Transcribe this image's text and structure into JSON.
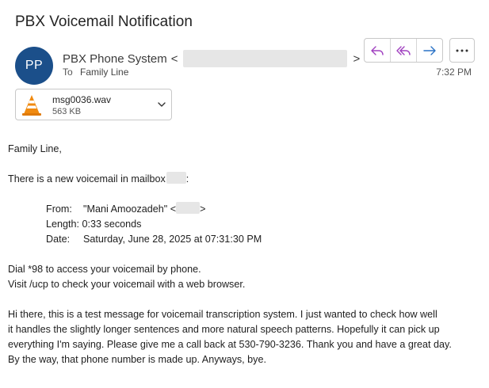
{
  "subject": "PBX Voicemail Notification",
  "sender": {
    "initials": "PP",
    "avatar_color": "#1b4f8a",
    "name": "PBX Phone System",
    "email_open": "<",
    "email_close": ">",
    "to_label": "To",
    "to_value": "Family Line"
  },
  "actions": {
    "icons": [
      "reply-icon",
      "reply-all-icon",
      "forward-icon",
      "more-icon"
    ],
    "accent": "#a040c0",
    "forward_color": "#2a72c5"
  },
  "time": "7:32 PM",
  "attachment": {
    "icon": "vlc-cone-icon",
    "filename": "msg0036.wav",
    "size": "563 KB"
  },
  "body": {
    "greeting": "Family Line,",
    "intro_before": "There is a new voicemail in mailbox",
    "intro_after": ":",
    "from_label": "From:",
    "from_value": "\"Mani Amoozadeh\" <",
    "from_close": ">",
    "length_label": "Length:",
    "length_value": "0:33 seconds",
    "date_label": "Date:",
    "date_value": "Saturday, June 28, 2025 at 07:31:30 PM",
    "dial_line": "Dial *98 to access your voicemail by phone.",
    "visit_line": "Visit /ucp to check your voicemail with a web browser.",
    "transcript": [
      "Hi there, this is a test message for voicemail transcription system. I just wanted to check how well",
      "it handles the slightly longer sentences and more natural speech patterns. Hopefully it can pick up",
      "everything I'm saying. Please give me a call back at 530-790-3236. Thank you and have a great day.",
      "By the way, that phone number is made up. Anyways, bye."
    ]
  }
}
